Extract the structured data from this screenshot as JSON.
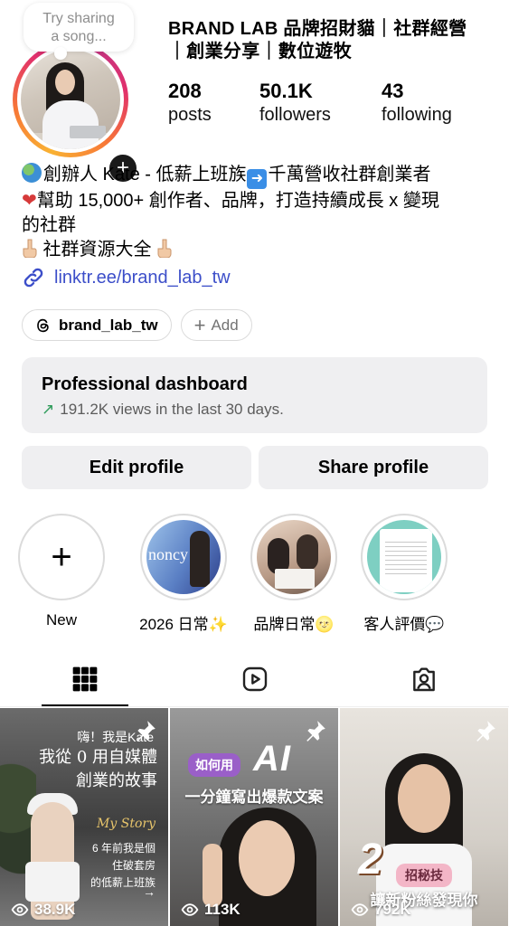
{
  "profile": {
    "note": "Try sharing\na song...",
    "name_line1": "BRAND LAB 品牌招財貓｜社群經營",
    "name_line2": "｜創業分享｜數位遊牧",
    "stats": [
      {
        "value": "208",
        "label": "posts"
      },
      {
        "value": "50.1K",
        "label": "followers"
      },
      {
        "value": "43",
        "label": "following"
      }
    ]
  },
  "bio": {
    "line1": "創辦人 Kate - 低薪上班族",
    "line1b": "千萬營收社群創業者",
    "line2": "幫助 15,000+ 創作者、品牌，打造持續成長 x 變現",
    "line3": "的社群",
    "line4": " 社群資源大全 ",
    "link": "linktr.ee/brand_lab_tw"
  },
  "chips": {
    "threads": "brand_lab_tw",
    "add": "Add"
  },
  "dashboard": {
    "title": "Professional dashboard",
    "subtitle": "191.2K views in the last 30 days."
  },
  "actions": {
    "edit": "Edit profile",
    "share": "Share profile"
  },
  "highlights": [
    {
      "label": "New"
    },
    {
      "label": "2026 日常✨"
    },
    {
      "label": "品牌日常🌝"
    },
    {
      "label": "客人評價💬"
    }
  ],
  "highlight_text": {
    "h1": "noncy"
  },
  "posts": [
    {
      "views": "38.9K",
      "small_top": "嗨！我是Kate",
      "title_line1": "我從 0 用自媒體",
      "title_line2": "創業的故事",
      "mystory": "My Story",
      "sub_line1": "6 年前我是個",
      "sub_line2": "住破套房",
      "sub_line3": "的低薪上班族"
    },
    {
      "views": "113K",
      "tag": "如何用",
      "ai": "AI",
      "line2": "一分鐘寫出爆款文案"
    },
    {
      "views": "792K",
      "num": "2",
      "tag": "招秘技",
      "caption": "讓新粉絲發現你"
    }
  ],
  "colors": {
    "link": "#3c4ec9",
    "trend": "#2e9b5a",
    "button_bg": "#efeff1"
  }
}
